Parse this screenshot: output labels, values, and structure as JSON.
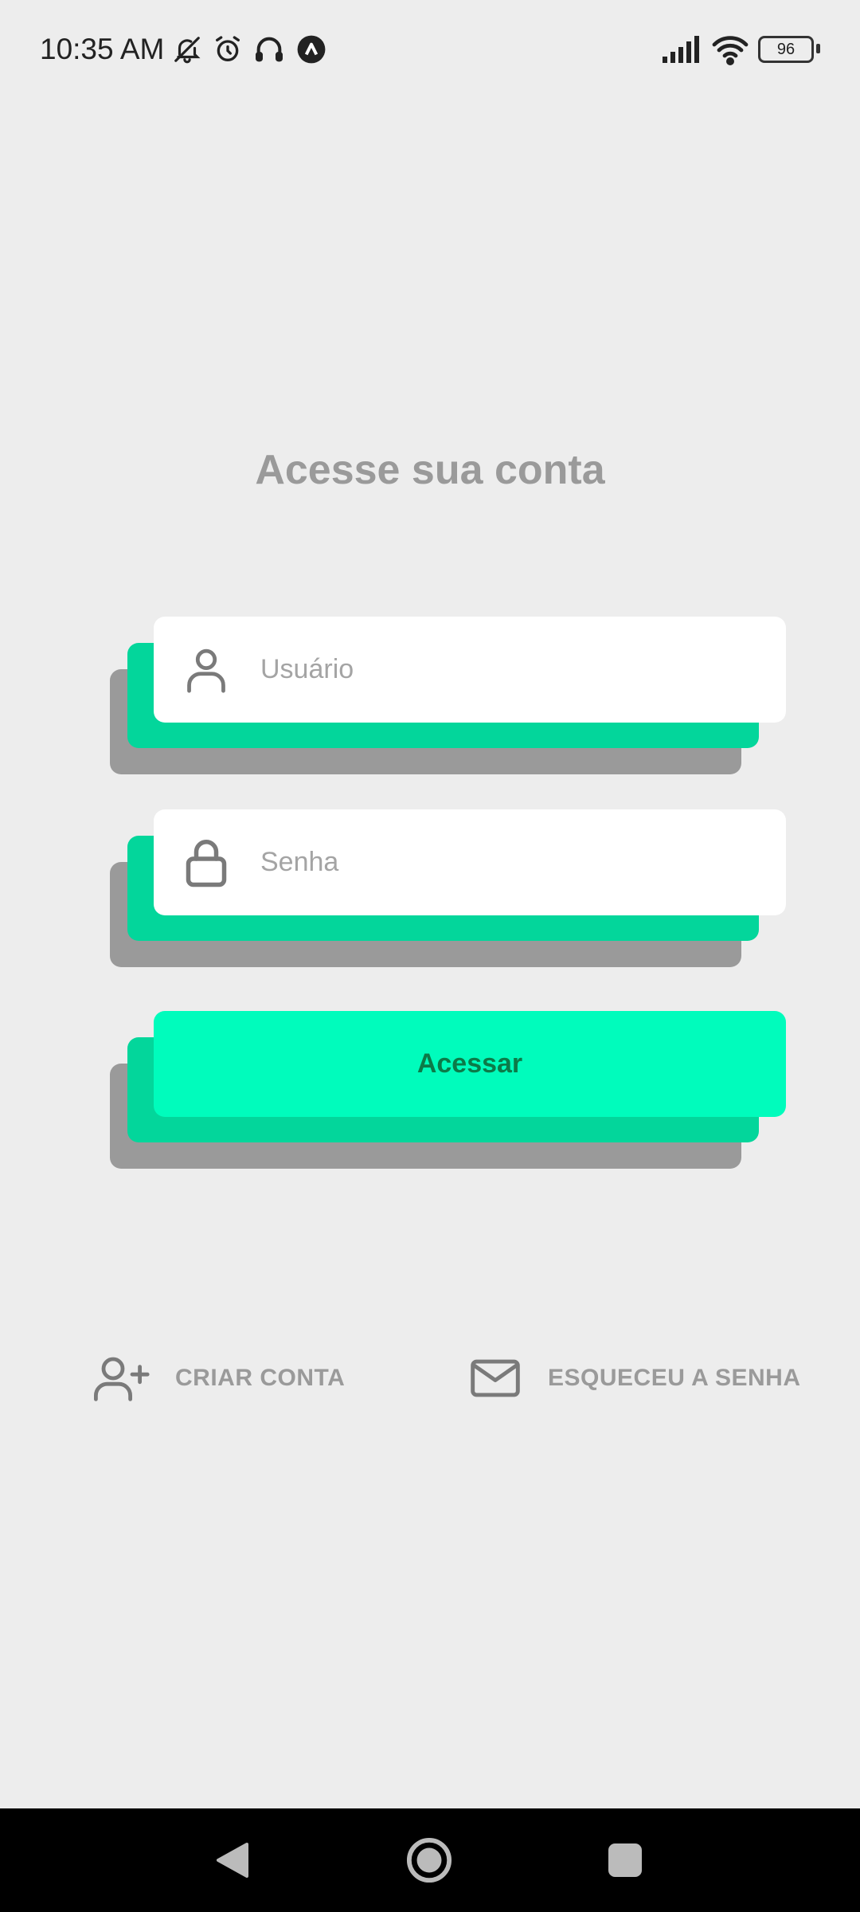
{
  "status_bar": {
    "time": "10:35 AM",
    "battery_level": "96",
    "icons": [
      "bell-off-icon",
      "alarm-icon",
      "headphones-icon",
      "app-icon",
      "signal-icon",
      "wifi-icon",
      "battery-icon"
    ]
  },
  "login": {
    "title": "Acesse sua conta",
    "username": {
      "placeholder": "Usuário",
      "value": "",
      "icon": "user-icon"
    },
    "password": {
      "placeholder": "Senha",
      "value": "",
      "icon": "lock-icon"
    },
    "submit_label": "Acessar"
  },
  "links": {
    "create_account": {
      "label": "CRIAR CONTA",
      "icon": "user-plus-icon"
    },
    "forgot_password": {
      "label": "ESQUECEU A SENHA",
      "icon": "mail-icon"
    }
  },
  "nav": {
    "buttons": [
      "back-icon",
      "home-icon",
      "recents-icon"
    ]
  },
  "colors": {
    "background": "#ededed",
    "accent": "#00fcbc",
    "accent_dark": "#03d69b",
    "shadow": "#9a9a9a",
    "button_text": "#0c7a48"
  }
}
